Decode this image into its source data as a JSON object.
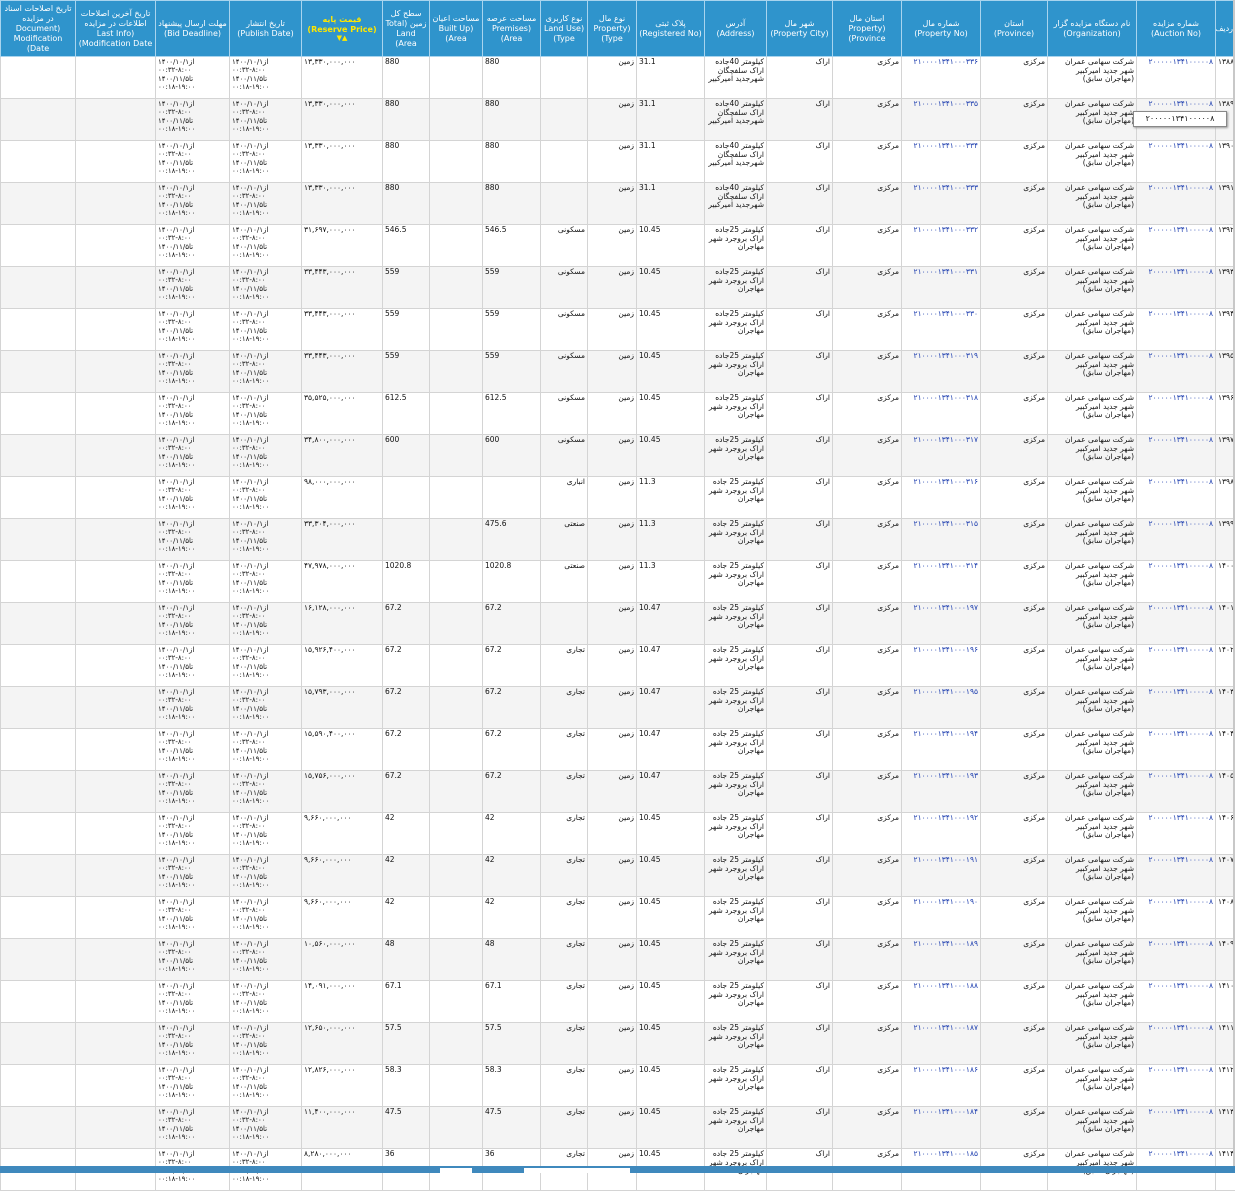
{
  "header": {
    "row_index": "ردیف",
    "auction_no": "شماره مزایده (Auction No)",
    "organization": "نام دستگاه مزایده گزار (Organization)",
    "province": "استان (Province)",
    "property_no": "شماره مال (Property No)",
    "property_province": "استان مال (Property Province)",
    "property_city": "شهر مال (Property City)",
    "address": "آدرس (Address)",
    "registered_no": "پلاک ثبتی (Registered No)",
    "property_type": "نوع مال (Property Type)",
    "land_use": "نوع کاربری (Land Use Type)",
    "premises_area": "مساحت عرصه (Premises Area)",
    "built_up_area": "مساحت اعیان (Built Up Area)",
    "total_land_area": "سطح کل زمین (Total Land Area)",
    "reserve_price": "قیمت پایه (Reserve Price)",
    "sort_marker": "▲▼",
    "publish_date": "تاریخ انتشار (Publish Date)",
    "bid_deadline": "مهلت ارسال پیشنهاد (Bid Deadline)",
    "last_info_modification": "تاریخ آخرین اصلاحات اطلاعات در مزایده (Last Info Modification Date)",
    "document_modification": "تاریخ اصلاحات اسناد در مزایده (Document Modification Date)"
  },
  "tooltip_text": "۲۰۰۰۰۰۱۳۴۱۰۰۰۰۰۸",
  "common": {
    "auction_no": "۲۰۰۰۰۰۱۳۴۱۰۰۰۰۰۸",
    "organization": "شرکت سهامی عمران شهر جدید امیرکبیر (مهاجران سابق)",
    "province": "مرکزی",
    "property_province": "مرکزی",
    "property_city": "اراک",
    "property_type": "زمین",
    "publish_date": "از۱۴۰۰/۱۰/۱\n۰۰:۳۲-۸:۰۰\nتا۱۴۰۰/۱۱/۵\n۰۰:۱۸-۱۹:۰۰",
    "bid_deadline": "از۱۴۰۰/۱۰/۱\n۰۰:۳۲-۸:۰۰\nتا۱۴۰۰/۱۱/۵\n۰۰:۱۸-۱۹:۰۰"
  },
  "rows": [
    {
      "idx": "۱۳۸۸",
      "property_no": "۲۱۰۰۰۰۱۳۴۱۰۰۰۳۳۶",
      "address": "کیلومتر 40جاده اراک سلفچگان شهرجدید امیرکبیر",
      "registered": "31.1",
      "land_use": "",
      "premises": "880",
      "built": "",
      "total": "880",
      "price": "۱۳,۳۳۰,۰۰۰,۰۰۰"
    },
    {
      "idx": "۱۳۸۹",
      "property_no": "۲۱۰۰۰۰۱۳۴۱۰۰۰۳۳۵",
      "address": "کیلومتر 40جاده اراک سلفچگان شهرجدید امیرکبیر",
      "registered": "31.1",
      "land_use": "",
      "premises": "880",
      "built": "",
      "total": "880",
      "price": "۱۳,۳۳۰,۰۰۰,۰۰۰"
    },
    {
      "idx": "۱۳۹۰",
      "property_no": "۲۱۰۰۰۰۱۳۴۱۰۰۰۳۳۴",
      "address": "کیلومتر 40جاده اراک سلفچگان شهرجدید امیرکبیر",
      "registered": "31.1",
      "land_use": "",
      "premises": "880",
      "built": "",
      "total": "880",
      "price": "۱۳,۳۳۰,۰۰۰,۰۰۰"
    },
    {
      "idx": "۱۳۹۱",
      "property_no": "۲۱۰۰۰۰۱۳۴۱۰۰۰۳۳۳",
      "address": "کیلومتر 40جاده اراک سلفچگان شهرجدید امیرکبیر",
      "registered": "31.1",
      "land_use": "",
      "premises": "880",
      "built": "",
      "total": "880",
      "price": "۱۳,۳۳۰,۰۰۰,۰۰۰"
    },
    {
      "idx": "۱۳۹۲",
      "property_no": "۲۱۰۰۰۰۱۳۴۱۰۰۰۳۳۲",
      "address": "کیلومتر 25جاده اراک بروجرد شهر مهاجران",
      "registered": "10.45",
      "land_use": "مسکونی",
      "premises": "546.5",
      "built": "",
      "total": "546.5",
      "price": "۳۱,۶۹۷,۰۰۰,۰۰۰"
    },
    {
      "idx": "۱۳۹۳",
      "property_no": "۲۱۰۰۰۰۱۳۴۱۰۰۰۳۳۱",
      "address": "کیلومتر 25جاده اراک بروجرد شهر مهاجران",
      "registered": "10.45",
      "land_use": "مسکونی",
      "premises": "559",
      "built": "",
      "total": "559",
      "price": "۳۳,۴۴۳,۰۰۰,۰۰۰"
    },
    {
      "idx": "۱۳۹۴",
      "property_no": "۲۱۰۰۰۰۱۳۴۱۰۰۰۳۳۰",
      "address": "کیلومتر 25جاده اراک بروجرد شهر مهاجران",
      "registered": "10.45",
      "land_use": "مسکونی",
      "premises": "559",
      "built": "",
      "total": "559",
      "price": "۳۳,۴۴۳,۰۰۰,۰۰۰"
    },
    {
      "idx": "۱۳۹۵",
      "property_no": "۲۱۰۰۰۰۱۳۴۱۰۰۰۳۱۹",
      "address": "کیلومتر 25جاده اراک بروجرد شهر مهاجران",
      "registered": "10.45",
      "land_use": "مسکونی",
      "premises": "559",
      "built": "",
      "total": "559",
      "price": "۳۳,۴۴۳,۰۰۰,۰۰۰"
    },
    {
      "idx": "۱۳۹۶",
      "property_no": "۲۱۰۰۰۰۱۳۴۱۰۰۰۳۱۸",
      "address": "کیلومتر 25جاده اراک بروجرد شهر مهاجران",
      "registered": "10.45",
      "land_use": "مسکونی",
      "premises": "612.5",
      "built": "",
      "total": "612.5",
      "price": "۳۵,۵۲۵,۰۰۰,۰۰۰"
    },
    {
      "idx": "۱۳۹۷",
      "property_no": "۲۱۰۰۰۰۱۳۴۱۰۰۰۳۱۷",
      "address": "کیلومتر 25جاده اراک بروجرد شهر مهاجران",
      "registered": "10.45",
      "land_use": "مسکونی",
      "premises": "600",
      "built": "",
      "total": "600",
      "price": "۳۴,۸۰۰,۰۰۰,۰۰۰"
    },
    {
      "idx": "۱۳۹۸",
      "property_no": "۲۱۰۰۰۰۱۳۴۱۰۰۰۳۱۶",
      "address": "کیلومتر 25 جاده اراک بروجرد شهر مهاجران",
      "registered": "11.3",
      "land_use": "انباری",
      "premises": "",
      "built": "",
      "total": "",
      "price": "۹۸,۰۰۰,۰۰۰,۰۰۰"
    },
    {
      "idx": "۱۳۹۹",
      "property_no": "۲۱۰۰۰۰۱۳۴۱۰۰۰۳۱۵",
      "address": "کیلومتر 25 جاده اراک بروجرد شهر مهاجران",
      "registered": "11.3",
      "land_use": "صنعتی",
      "premises": "475.6",
      "built": "",
      "total": "",
      "price": "۳۳,۳۰۴,۰۰۰,۰۰۰"
    },
    {
      "idx": "۱۴۰۰",
      "property_no": "۲۱۰۰۰۰۱۳۴۱۰۰۰۳۱۴",
      "address": "کیلومتر 25 جاده اراک بروجرد شهر مهاجران",
      "registered": "11.3",
      "land_use": "صنعتی",
      "premises": "1020.8",
      "built": "",
      "total": "1020.8",
      "price": "۴۷,۹۷۸,۰۰۰,۰۰۰"
    },
    {
      "idx": "۱۴۰۱",
      "property_no": "۲۱۰۰۰۰۱۳۴۱۰۰۰۱۹۷",
      "address": "کیلومتر 25 جاده اراک بروجرد شهر مهاجران",
      "registered": "10.47",
      "land_use": "",
      "premises": "67.2",
      "built": "",
      "total": "67.2",
      "price": "۱۶,۱۲۸,۰۰۰,۰۰۰"
    },
    {
      "idx": "۱۴۰۲",
      "property_no": "۲۱۰۰۰۰۱۳۴۱۰۰۰۱۹۶",
      "address": "کیلومتر 25 جاده اراک بروجرد شهر مهاجران",
      "registered": "10.47",
      "land_use": "تجاری",
      "premises": "67.2",
      "built": "",
      "total": "67.2",
      "price": "۱۵,۹۲۶,۴۰۰,۰۰۰"
    },
    {
      "idx": "۱۴۰۳",
      "property_no": "۲۱۰۰۰۰۱۳۴۱۰۰۰۱۹۵",
      "address": "کیلومتر 25 جاده اراک بروجرد شهر مهاجران",
      "registered": "10.47",
      "land_use": "تجاری",
      "premises": "67.2",
      "built": "",
      "total": "67.2",
      "price": "۱۵,۷۹۳,۰۰۰,۰۰۰"
    },
    {
      "idx": "۱۴۰۴",
      "property_no": "۲۱۰۰۰۰۱۳۴۱۰۰۰۱۹۴",
      "address": "کیلومتر 25 جاده اراک بروجرد شهر مهاجران",
      "registered": "10.47",
      "land_use": "تجاری",
      "premises": "67.2",
      "built": "",
      "total": "67.2",
      "price": "۱۵,۵۹۰,۴۰۰,۰۰۰"
    },
    {
      "idx": "۱۴۰۵",
      "property_no": "۲۱۰۰۰۰۱۳۴۱۰۰۰۱۹۳",
      "address": "کیلومتر 25 جاده اراک بروجرد شهر مهاجران",
      "registered": "10.47",
      "land_use": "تجاری",
      "premises": "67.2",
      "built": "",
      "total": "67.2",
      "price": "۱۵,۷۵۶,۰۰۰,۰۰۰"
    },
    {
      "idx": "۱۴۰۶",
      "property_no": "۲۱۰۰۰۰۱۳۴۱۰۰۰۱۹۲",
      "address": "کیلومتر 25 جاده اراک بروجرد شهر مهاجران",
      "registered": "10.45",
      "land_use": "تجاری",
      "premises": "42",
      "built": "",
      "total": "42",
      "price": "۹,۶۶۰,۰۰۰,۰۰۰"
    },
    {
      "idx": "۱۴۰۷",
      "property_no": "۲۱۰۰۰۰۱۳۴۱۰۰۰۱۹۱",
      "address": "کیلومتر 25 جاده اراک بروجرد شهر مهاجران",
      "registered": "10.45",
      "land_use": "تجاری",
      "premises": "42",
      "built": "",
      "total": "42",
      "price": "۹,۶۶۰,۰۰۰,۰۰۰"
    },
    {
      "idx": "۱۴۰۸",
      "property_no": "۲۱۰۰۰۰۱۳۴۱۰۰۰۱۹۰",
      "address": "کیلومتر 25 جاده اراک بروجرد شهر مهاجران",
      "registered": "10.45",
      "land_use": "تجاری",
      "premises": "42",
      "built": "",
      "total": "42",
      "price": "۹,۶۶۰,۰۰۰,۰۰۰"
    },
    {
      "idx": "۱۴۰۹",
      "property_no": "۲۱۰۰۰۰۱۳۴۱۰۰۰۱۸۹",
      "address": "کیلومتر 25 جاده اراک بروجرد شهر مهاجران",
      "registered": "10.45",
      "land_use": "تجاری",
      "premises": "48",
      "built": "",
      "total": "48",
      "price": "۱۰,۵۶۰,۰۰۰,۰۰۰"
    },
    {
      "idx": "۱۴۱۰",
      "property_no": "۲۱۰۰۰۰۱۳۴۱۰۰۰۱۸۸",
      "address": "کیلومتر 25 جاده اراک بروجرد شهر مهاجران",
      "registered": "10.45",
      "land_use": "تجاری",
      "premises": "67.1",
      "built": "",
      "total": "67.1",
      "price": "۱۴,۰۹۱,۰۰۰,۰۰۰"
    },
    {
      "idx": "۱۴۱۱",
      "property_no": "۲۱۰۰۰۰۱۳۴۱۰۰۰۱۸۷",
      "address": "کیلومتر 25 جاده اراک بروجرد شهر مهاجران",
      "registered": "10.45",
      "land_use": "تجاری",
      "premises": "57.5",
      "built": "",
      "total": "57.5",
      "price": "۱۲,۶۵۰,۰۰۰,۰۰۰"
    },
    {
      "idx": "۱۴۱۲",
      "property_no": "۲۱۰۰۰۰۱۳۴۱۰۰۰۱۸۶",
      "address": "کیلومتر 25 جاده اراک بروجرد شهر مهاجران",
      "registered": "10.45",
      "land_use": "تجاری",
      "premises": "58.3",
      "built": "",
      "total": "58.3",
      "price": "۱۲,۸۲۶,۰۰۰,۰۰۰"
    },
    {
      "idx": "۱۴۱۳",
      "property_no": "۲۱۰۰۰۰۱۳۴۱۰۰۰۱۸۴",
      "address": "کیلومتر 25 جاده اراک بروجرد شهر مهاجران",
      "registered": "10.45",
      "land_use": "تجاری",
      "premises": "47.5",
      "built": "",
      "total": "47.5",
      "price": "۱۱,۴۰۰,۰۰۰,۰۰۰"
    },
    {
      "idx": "۱۴۱۴",
      "property_no": "۲۱۰۰۰۰۱۳۴۱۰۰۰۱۸۵",
      "address": "کیلومتر 25 جاده اراک بروجرد شهر مهاجران",
      "registered": "10.45",
      "land_use": "تجاری",
      "premises": "36",
      "built": "",
      "total": "36",
      "price": "۸,۲۸۰,۰۰۰,۰۰۰"
    }
  ]
}
